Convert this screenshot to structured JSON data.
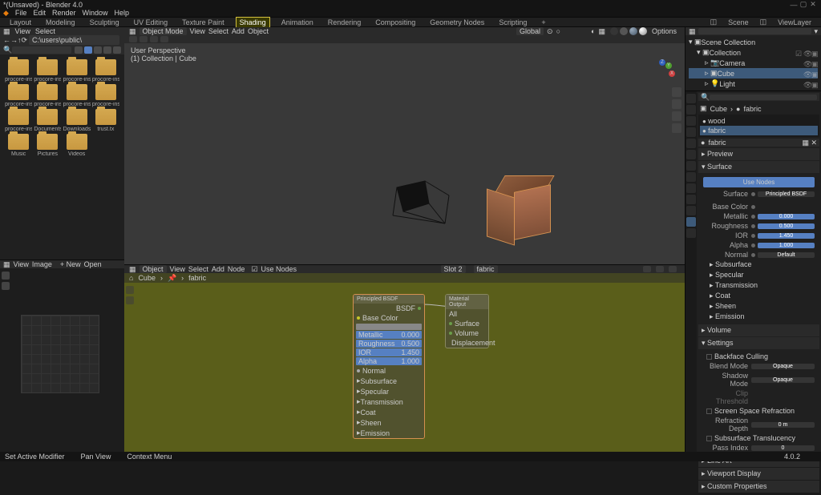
{
  "title": "*(Unsaved) - Blender 4.0",
  "menu": [
    "File",
    "Edit",
    "Render",
    "Window",
    "Help"
  ],
  "workspaces": [
    "Layout",
    "Modeling",
    "Sculpting",
    "UV Editing",
    "Texture Paint",
    "Shading",
    "Animation",
    "Rendering",
    "Compositing",
    "Geometry Nodes",
    "Scripting"
  ],
  "active_ws": "Shading",
  "scene": "Scene",
  "viewlayer": "ViewLayer",
  "fb": {
    "menus": [
      "View",
      "Select"
    ],
    "path": "C:\\users\\public\\",
    "folders": [
      {
        "name": "procore-ins..."
      },
      {
        "name": "procore-ins..."
      },
      {
        "name": "procore-ins..."
      },
      {
        "name": "procore-ins..."
      },
      {
        "name": "procore-ins..."
      },
      {
        "name": "procore-ins..."
      },
      {
        "name": "procore-ins..."
      },
      {
        "name": "procore-ins..."
      },
      {
        "name": "procore-ins..."
      },
      {
        "name": "Documents"
      },
      {
        "name": "Downloads"
      },
      {
        "name": "trust.tx"
      },
      {
        "name": "Music"
      },
      {
        "name": "Pictures"
      },
      {
        "name": "Videos"
      }
    ]
  },
  "uv": {
    "menus": [
      "View",
      "Image"
    ],
    "new": "+ New",
    "open": "Open"
  },
  "vp": {
    "mode": "Object Mode",
    "menus": [
      "View",
      "Select",
      "Add",
      "Object"
    ],
    "orient": "Global",
    "info_line1": "User Perspective",
    "info_line2": "(1) Collection | Cube",
    "options": "Options"
  },
  "node_header": {
    "mode": "Object",
    "menus": [
      "View",
      "Select",
      "Add",
      "Node"
    ],
    "use_nodes": "Use Nodes",
    "slot": "Slot 2",
    "mat": "fabric"
  },
  "node_bc": {
    "obj": "Cube",
    "mat": "fabric"
  },
  "nodes": {
    "bsdf": {
      "title": "Principled BSDF",
      "out": "BSDF",
      "base": "Base Color",
      "sliders": [
        {
          "l": "Metallic",
          "v": "0.000"
        },
        {
          "l": "Roughness",
          "v": "0.500"
        },
        {
          "l": "IOR",
          "v": "1.450"
        },
        {
          "l": "Alpha",
          "v": "1.000"
        }
      ],
      "groups": [
        "Normal",
        "Subsurface",
        "Specular",
        "Transmission",
        "Coat",
        "Sheen",
        "Emission"
      ]
    },
    "out": {
      "title": "Material Output",
      "target": "All",
      "ins": [
        "Surface",
        "Volume",
        "Displacement"
      ]
    }
  },
  "outliner": {
    "root": "Scene Collection",
    "coll": "Collection",
    "items": [
      {
        "n": "Camera"
      },
      {
        "n": "Cube",
        "sel": true
      },
      {
        "n": "Light"
      }
    ]
  },
  "props": {
    "bc_obj": "Cube",
    "bc_mat": "fabric",
    "mats": [
      {
        "n": "wood"
      },
      {
        "n": "fabric",
        "sel": true
      }
    ],
    "mat_name": "fabric",
    "preview": "Preview",
    "surf_head": "Surface",
    "use_nodes": "Use Nodes",
    "surf_label": "Surface",
    "surf_val": "Principled BSDF",
    "rows": [
      {
        "l": "Base Color",
        "t": "col"
      },
      {
        "l": "Metallic",
        "v": "0.000"
      },
      {
        "l": "Roughness",
        "v": "0.500"
      },
      {
        "l": "IOR",
        "v": "1.450"
      },
      {
        "l": "Alpha",
        "v": "1.000"
      },
      {
        "l": "Normal",
        "v": "Default",
        "t": "dark"
      }
    ],
    "sections": [
      "Subsurface",
      "Specular",
      "Transmission",
      "Coat",
      "Sheen",
      "Emission"
    ],
    "vol": "Volume",
    "settings": "Settings",
    "set": {
      "bf": "Backface Culling",
      "blend_l": "Blend Mode",
      "blend_v": "Opaque",
      "shadow_l": "Shadow Mode",
      "shadow_v": "Opaque",
      "clip_l": "Clip Threshold",
      "ssr": "Screen Space Refraction",
      "rd_l": "Refraction Depth",
      "rd_v": "0 m",
      "sst": "Subsurface Translucency",
      "pi_l": "Pass Index",
      "pi_v": "0"
    },
    "extra": [
      "Line Art",
      "Viewport Display",
      "Custom Properties"
    ]
  },
  "status": {
    "a": "Set Active Modifier",
    "b": "Pan View",
    "c": "Context Menu",
    "ver": "4.0.2"
  }
}
